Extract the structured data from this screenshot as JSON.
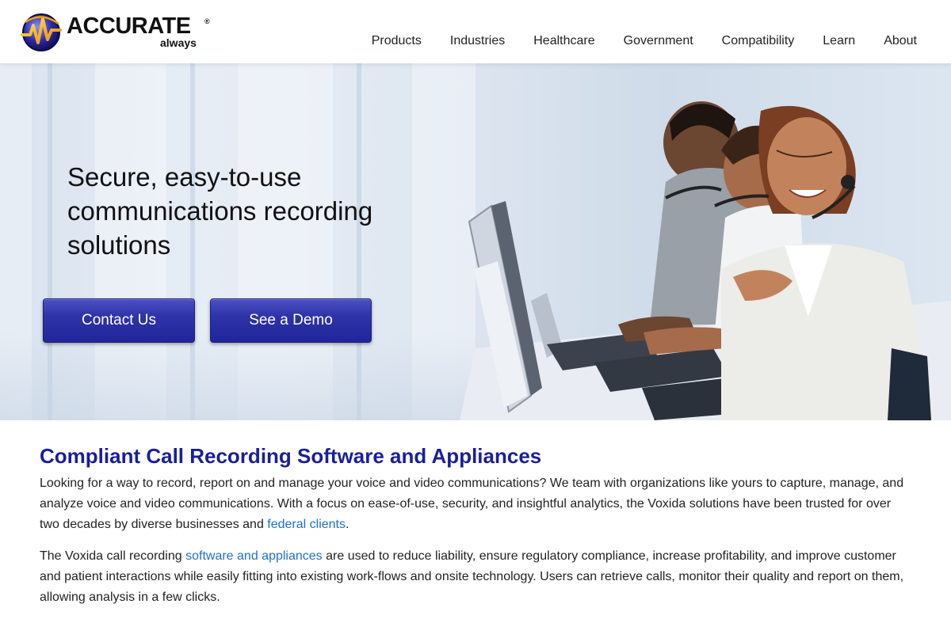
{
  "brand": {
    "name": "ACCURATE",
    "registered": "®",
    "tagline": "always"
  },
  "nav": {
    "items": [
      "Products",
      "Industries",
      "Healthcare",
      "Government",
      "Compatibility",
      "Learn",
      "About"
    ]
  },
  "hero": {
    "title": "Secure, easy-to-use communications recording solutions",
    "contact_label": "Contact Us",
    "demo_label": "See a Demo"
  },
  "content": {
    "title": "Compliant Call Recording Software and Appliances",
    "para1_before": "Looking for a way to record, report on and manage your voice and video communications? We team with organizations like yours to capture, manage, and analyze voice and video communications. With a focus on ease-of-use, security, and insightful analytics, the Voxida solutions have been trusted for over two decades by diverse businesses and ",
    "para1_link": "federal clients",
    "para1_after": ".",
    "para2_before": "The Voxida call recording ",
    "para2_link": "software and appliances",
    "para2_after": " are used to reduce liability, ensure regulatory compliance, increase profitability, and improve customer and patient interactions while easily fitting into existing work-flows and onsite technology. Users can retrieve calls, monitor their quality and report on them, allowing analysis in a few clicks."
  },
  "colors": {
    "accent_blue": "#1a1f9a",
    "button_blue": "#2e33a8",
    "link_blue": "#1f6fd1"
  }
}
